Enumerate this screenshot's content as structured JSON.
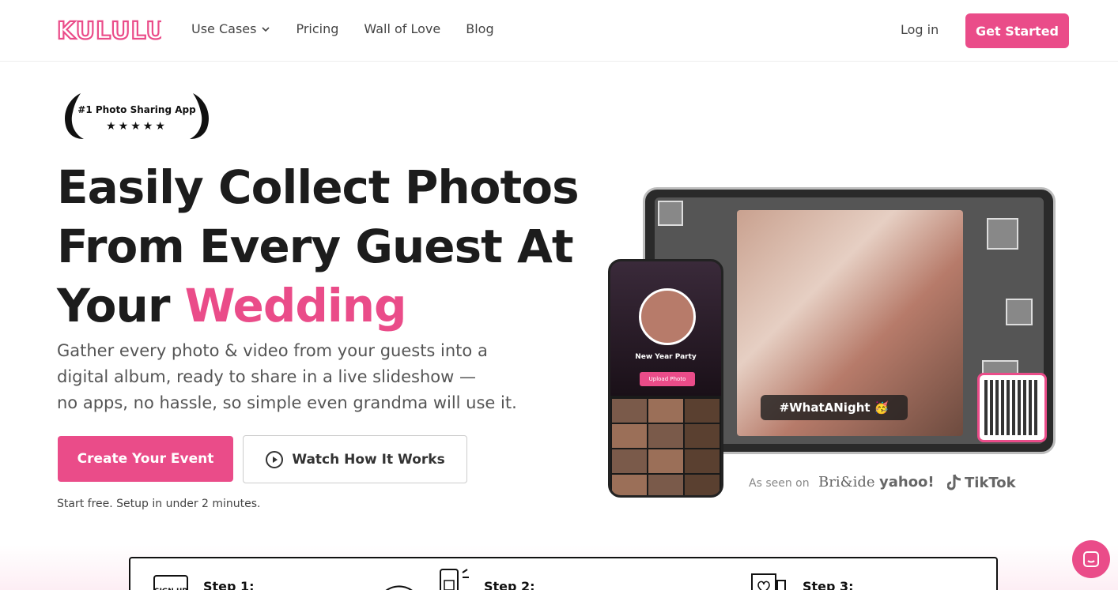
{
  "nav": {
    "logo_text": "KULULU",
    "links": [
      {
        "label": "Use Cases",
        "has_dropdown": true
      },
      {
        "label": "Pricing"
      },
      {
        "label": "Wall of Love"
      },
      {
        "label": "Blog"
      }
    ],
    "login_label": "Log in",
    "cta_label": "Get Started"
  },
  "badge": {
    "text": "#1 Photo Sharing App",
    "stars": "★★★★★",
    "icon": "laurel-wreath-icon"
  },
  "hero": {
    "headline_line1": "Easily Collect Photos",
    "headline_line2": "From Every Guest At",
    "headline_line3_prefix": "Your ",
    "headline_accent": "Wedding",
    "sub_line1": "Gather every photo & video from your guests into a",
    "sub_line2": "digital album, ready to share in a live slideshow —",
    "sub_line3": "no apps, no hassle, so simple even grandma will use it.",
    "primary_cta": "Create Your Event",
    "secondary_cta": "Watch How It Works",
    "note": "Start free. Setup in under 2 minutes."
  },
  "visual": {
    "hashtag": "#WhatANight 🥳",
    "phone_title": "New Year Party",
    "phone_upload": "Upload Photo"
  },
  "press": {
    "label": "As seen on",
    "outlets": [
      "Bri&ide",
      "yahoo!",
      "TikTok"
    ]
  },
  "steps": [
    {
      "label": "Step 1:",
      "icon": "sign-up-icon"
    },
    {
      "label": "Step 2:",
      "icon": "phone-qr-icon"
    },
    {
      "label": "Step 3:",
      "icon": "photo-frame-icon"
    }
  ],
  "colors": {
    "accent": "#ea4c89",
    "text_dark": "#1c1c1c"
  }
}
